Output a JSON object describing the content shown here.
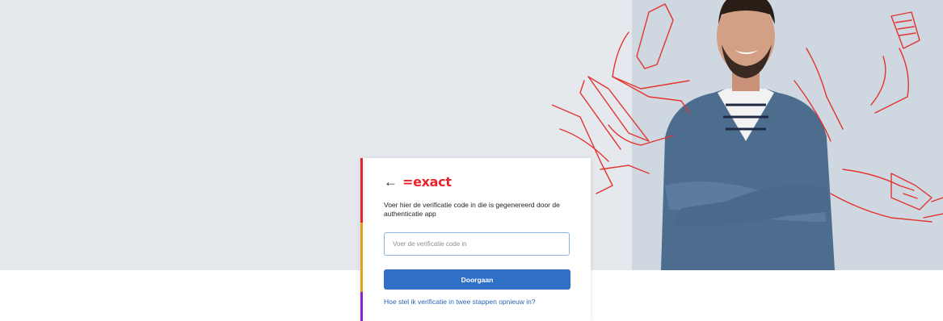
{
  "brand": {
    "logo_prefix": "=",
    "logo_text": "exact",
    "logo_color": "#e8242a",
    "back_icon": "arrow-left-icon"
  },
  "colors": {
    "primary_button": "#2f6fc8",
    "link": "#2a63b4",
    "stripe_red": "#e8242a",
    "stripe_orange": "#e4a217",
    "stripe_purple": "#8b1fd1",
    "line_art": "#e3342f"
  },
  "verification": {
    "instruction": "Voer hier de verificatie code in die is gegenereerd door de authenticatie app",
    "code_placeholder": "Voer de verificatie code in",
    "code_value": "",
    "continue_label": "Doorgaan",
    "reset_link": "Hoe stel ik verificatie in twee stappen opnieuw in?"
  }
}
